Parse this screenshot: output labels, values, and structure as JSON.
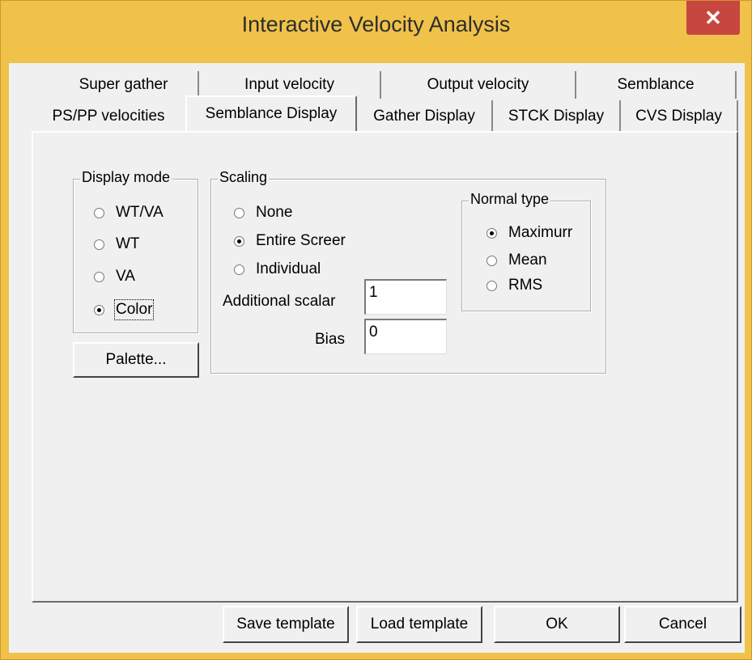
{
  "window": {
    "title": "Interactive Velocity Analysis",
    "close_glyph": "✕"
  },
  "tabs": {
    "back_row": [
      "Super gather",
      "Input velocity",
      "Output velocity",
      "Semblance"
    ],
    "front_row": [
      "PS/PP velocities",
      "Semblance Display",
      "Gather Display",
      "STCK Display",
      "CVS Display"
    ],
    "active": "Semblance Display"
  },
  "display_mode": {
    "label": "Display mode",
    "options": [
      "WT/VA",
      "WT",
      "VA",
      "Color"
    ],
    "selected": "Color"
  },
  "palette_button": "Palette...",
  "scaling": {
    "label": "Scaling",
    "options": [
      "None",
      "Entire Screer",
      "Individual"
    ],
    "selected": "Entire Screer",
    "additional_scalar_label": "Additional scalar",
    "additional_scalar_value": "1",
    "bias_label": "Bias",
    "bias_value": "0"
  },
  "normal_type": {
    "label": "Normal type",
    "options": [
      "Maximurr",
      "Mean",
      "RMS"
    ],
    "selected": "Maximurr"
  },
  "footer": {
    "save_template": "Save template",
    "load_template": "Load template",
    "ok": "OK",
    "cancel": "Cancel"
  },
  "colors": {
    "title_bar": "#f0c24a",
    "close_button": "#c7463f",
    "dialog_bg": "#f0f0f0"
  }
}
